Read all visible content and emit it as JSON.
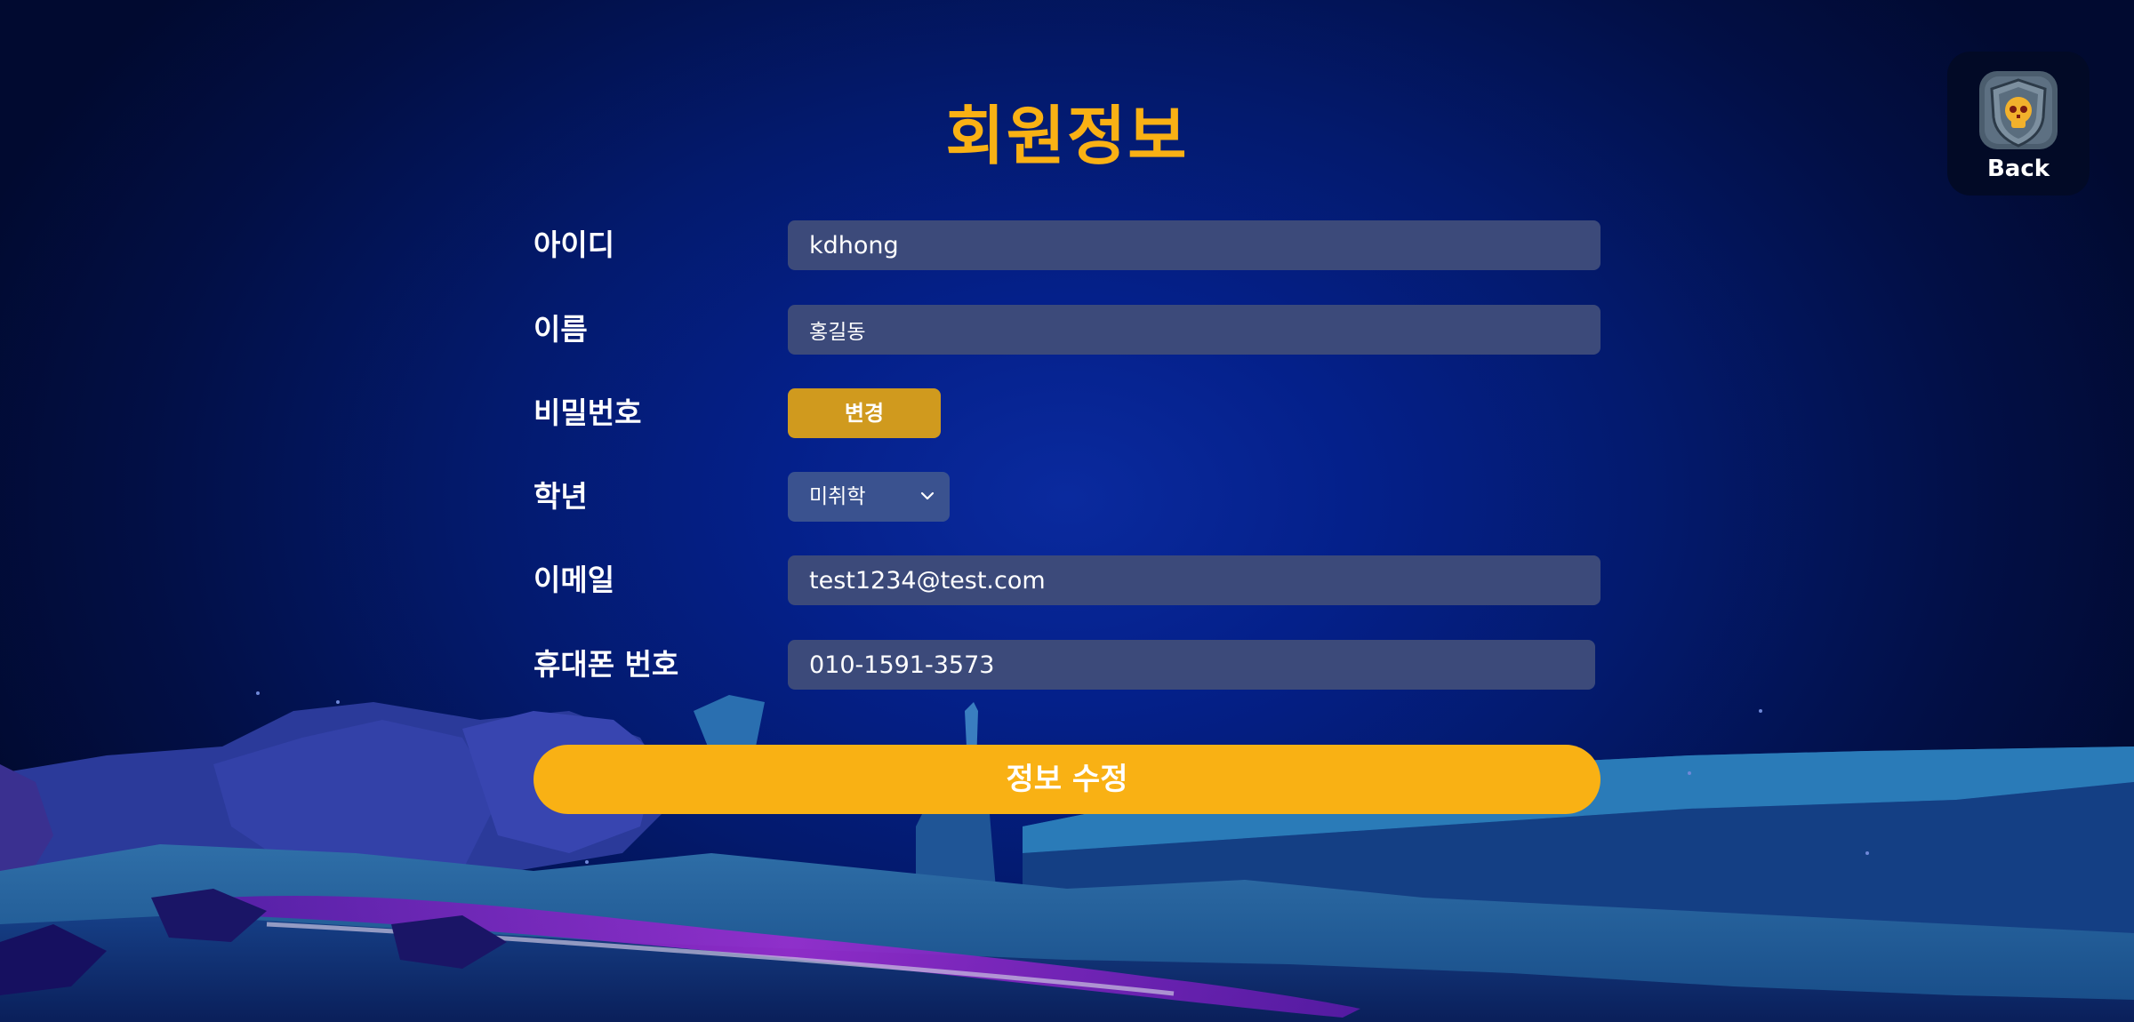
{
  "header": {
    "title": "회원정보"
  },
  "back_button": {
    "label": "Back",
    "icon": "skull-shield-icon"
  },
  "form": {
    "user_id": {
      "label": "아이디",
      "value": "kdhong"
    },
    "name": {
      "label": "이름",
      "value": "홍길동"
    },
    "password": {
      "label": "비밀번호",
      "button_label": "변경"
    },
    "grade": {
      "label": "학년",
      "selected": "미취학",
      "icon": "chevron-down-icon"
    },
    "email": {
      "label": "이메일",
      "value": "test1234@test.com"
    },
    "phone": {
      "label": "휴대폰 번호",
      "value": "010-1591-3573"
    }
  },
  "submit": {
    "label": "정보 수정"
  },
  "colors": {
    "accent": "#f9b114",
    "change_button": "#d09a1e",
    "field_bg": "#3c4a7a",
    "background": "#031a6e"
  }
}
